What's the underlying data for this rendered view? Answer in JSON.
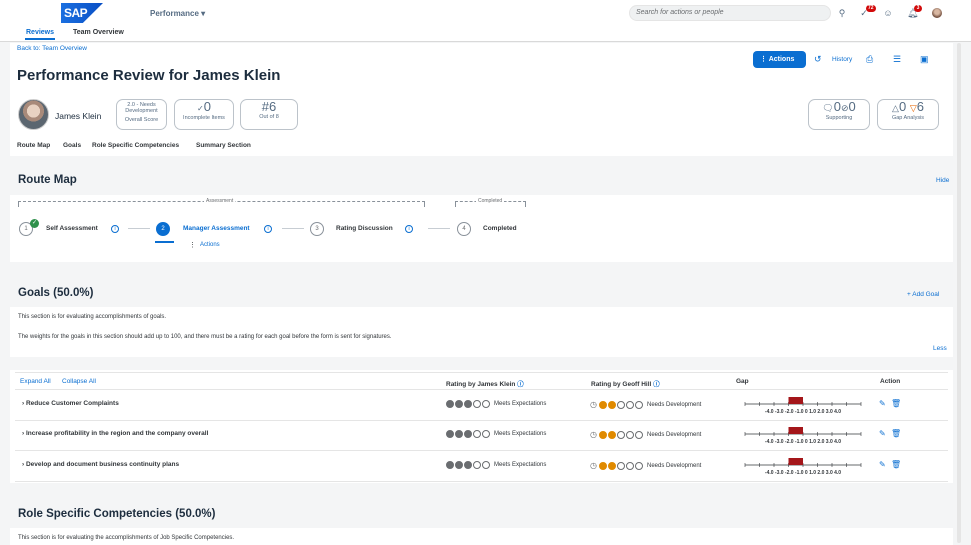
{
  "shell": {
    "logo": "SAP",
    "app_menu": "Performance",
    "search_placeholder": "Search for actions or people",
    "notifications_count": "72",
    "alerts_count": "3"
  },
  "tabs": [
    {
      "label": "Reviews",
      "active": true
    },
    {
      "label": "Team Overview",
      "active": false
    }
  ],
  "header": {
    "back_link": "Back to: Team Overview",
    "title": "Performance Review for James Klein",
    "actions_label": "Actions",
    "history_label": "History",
    "person_name": "James Klein",
    "overall_score_value": "2.0 - Needs Development",
    "overall_score_label": "Overall Score",
    "incomplete_value": "0",
    "incomplete_label": "Incomplete Items",
    "out_of_value": "6",
    "out_of_label": "Out of 8",
    "supporting_value1": "0",
    "supporting_value2": "0",
    "supporting_label": "Supporting",
    "gap_up": "0",
    "gap_down": "6",
    "gap_label": "Gap Analysis"
  },
  "anchors": [
    "Route Map",
    "Goals",
    "Role Specific Competencies",
    "Summary Section"
  ],
  "route_map": {
    "title": "Route Map",
    "hide_label": "Hide",
    "group_assessment": "Assessment",
    "group_completed": "Completed",
    "steps": [
      {
        "num": "1",
        "label": "Self Assessment",
        "state": "done"
      },
      {
        "num": "2",
        "label": "Manager Assessment",
        "state": "current"
      },
      {
        "num": "3",
        "label": "Rating Discussion",
        "state": "todo"
      },
      {
        "num": "4",
        "label": "Completed",
        "state": "todo"
      }
    ],
    "actions_link": "Actions"
  },
  "goals": {
    "title": "Goals (50.0%)",
    "add_label": "+ Add Goal",
    "desc1": "This section is for evaluating accomplishments of goals.",
    "desc2": "The weights for the goals in this section should add up to 100, and there must be a rating for each goal before the form is sent for signatures.",
    "less_label": "Less",
    "expand_all": "Expand All",
    "collapse_all": "Collapse All",
    "col_employee": "Rating by James Klein",
    "col_manager": "Rating by Geoff Hill",
    "col_gap": "Gap",
    "col_action": "Action",
    "gap_ticks": "-4.0 -3.0 -2.0 -1.0  0   1.0  2.0  3.0  4.0",
    "rows": [
      {
        "name": "Reduce Customer Complaints",
        "employee_rating": 3,
        "employee_text": "Meets Expectations",
        "manager_rating": 2,
        "manager_text": "Needs Development",
        "gap": -1.0
      },
      {
        "name": "Increase profitability in the region and the company overall",
        "employee_rating": 3,
        "employee_text": "Meets Expectations",
        "manager_rating": 2,
        "manager_text": "Needs Development",
        "gap": -1.0
      },
      {
        "name": "Develop and document business continuity plans",
        "employee_rating": 3,
        "employee_text": "Meets Expectations",
        "manager_rating": 2,
        "manager_text": "Needs Development",
        "gap": -1.0
      }
    ]
  },
  "competencies": {
    "title": "Role Specific Competencies (50.0%)",
    "desc": "This section is for evaluating the accomplishments of Job Specific Competencies."
  },
  "colors": {
    "accent": "#0a6ed1",
    "rating_orange": "#e08a00",
    "gap_red": "#a4161a"
  }
}
